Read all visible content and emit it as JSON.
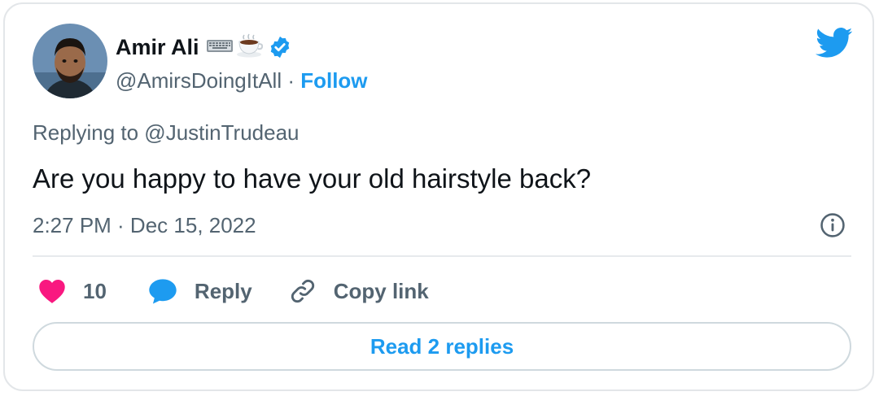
{
  "author": {
    "display_name": "Amir Ali",
    "name_emojis": [
      "keyboard-emoji",
      "coffee-emoji"
    ],
    "verified": true,
    "handle": "@AmirsDoingItAll",
    "separator": " · ",
    "follow_label": "Follow"
  },
  "tweet": {
    "replying_to": "Replying to @JustinTrudeau",
    "text": "Are you happy to have your old hairstyle back?",
    "timestamp": "2:27 PM · Dec 15, 2022"
  },
  "actions": {
    "like_count": "10",
    "reply_label": "Reply",
    "copy_link_label": "Copy link"
  },
  "footer": {
    "read_replies_label": "Read 2 replies"
  },
  "colors": {
    "accent": "#1d9bf0",
    "like": "#f91880",
    "text_primary": "#0f1419",
    "text_secondary": "#536471",
    "border": "#cfd9de"
  }
}
